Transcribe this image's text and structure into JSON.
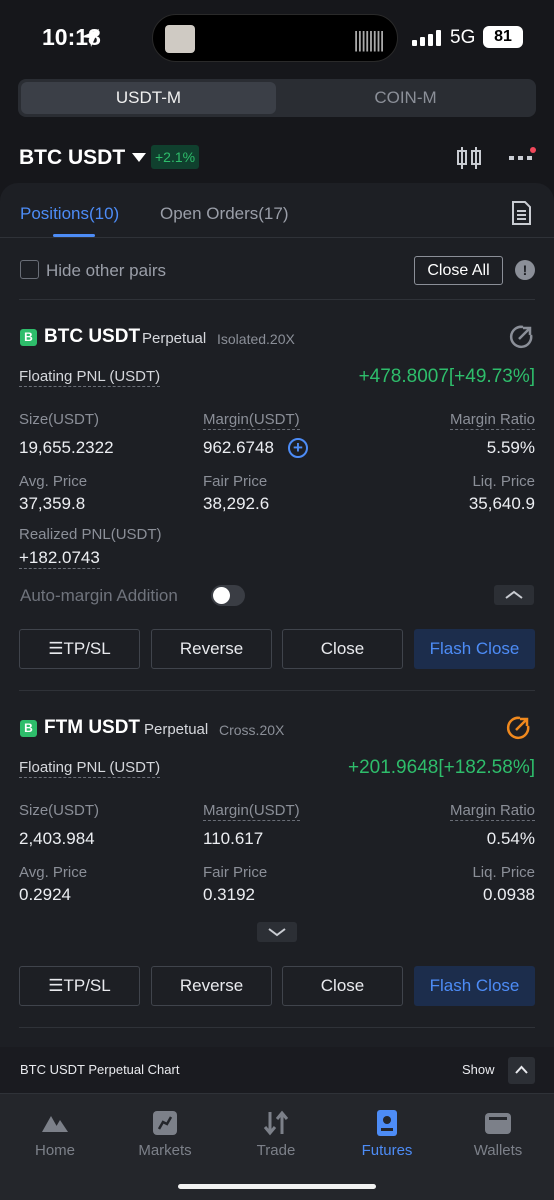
{
  "status": {
    "time": "10:18",
    "network": "5G",
    "battery": "81"
  },
  "segment": {
    "active": "USDT-M",
    "inactive": "COIN-M"
  },
  "header": {
    "pair": "BTC USDT",
    "change": "+2.1%"
  },
  "tabs": {
    "positions": "Positions(10)",
    "open_orders": "Open Orders(17)"
  },
  "filter": {
    "hide_label": "Hide other pairs",
    "close_all": "Close All"
  },
  "positions": [
    {
      "badge": "B",
      "title": "BTC USDT",
      "type": "Perpetual",
      "mode": "Isolated.20X",
      "pnl_label": "Floating PNL (USDT)",
      "pnl": "+478.8007[+49.73%]",
      "size_label": "Size(USDT)",
      "size": "19,655.2322",
      "margin_label": "Margin(USDT)",
      "margin": "962.6748",
      "ratio_label": "Margin Ratio",
      "ratio": "5.59%",
      "avg_label": "Avg. Price",
      "avg": "37,359.8",
      "fair_label": "Fair Price",
      "fair": "38,292.6",
      "liq_label": "Liq. Price",
      "liq": "35,640.9",
      "realized_label": "Realized PNL(USDT)",
      "realized": "+182.0743",
      "auto_label": "Auto-margin Addition",
      "share_color": "#8b8f98"
    },
    {
      "badge": "B",
      "title": "FTM USDT",
      "type": "Perpetual",
      "mode": "Cross.20X",
      "pnl_label": "Floating PNL (USDT)",
      "pnl": "+201.9648[+182.58%]",
      "size_label": "Size(USDT)",
      "size": "2,403.984",
      "margin_label": "Margin(USDT)",
      "margin": "110.617",
      "ratio_label": "Margin Ratio",
      "ratio": "0.54%",
      "avg_label": "Avg. Price",
      "avg": "0.2924",
      "fair_label": "Fair Price",
      "fair": "0.3192",
      "liq_label": "Liq. Price",
      "liq": "0.0938",
      "share_color": "#f0891e"
    }
  ],
  "actions": {
    "tpsl": "☰TP/SL",
    "reverse": "Reverse",
    "close": "Close",
    "flash": "Flash Close"
  },
  "chart_bar": {
    "label": "BTC USDT Perpetual Chart",
    "show": "Show"
  },
  "nav": [
    {
      "label": "Home",
      "icon": "home-icon"
    },
    {
      "label": "Markets",
      "icon": "markets-icon"
    },
    {
      "label": "Trade",
      "icon": "trade-icon"
    },
    {
      "label": "Futures",
      "icon": "futures-icon",
      "active": true
    },
    {
      "label": "Wallets",
      "icon": "wallet-icon"
    }
  ],
  "colors": {
    "accent": "#4d8cf6",
    "positive": "#2ebd6b",
    "background": "#16171b",
    "panel": "#1d1f24"
  }
}
